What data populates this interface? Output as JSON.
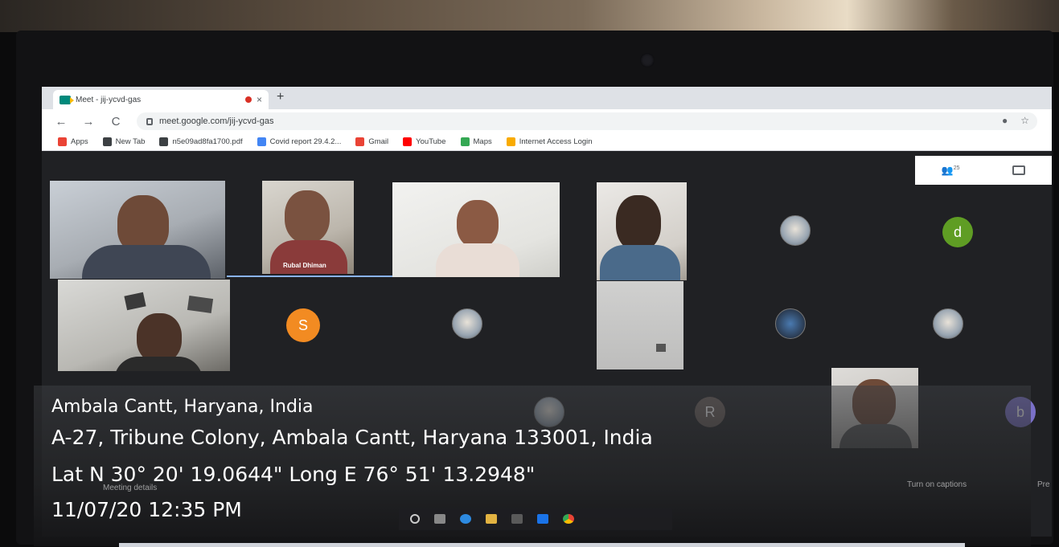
{
  "browser": {
    "tab_title": "Meet - jij-ycvd-gas",
    "tab_close": "×",
    "new_tab": "+",
    "back": "←",
    "forward": "→",
    "reload": "C",
    "url": "meet.google.com/jij-ycvd-gas",
    "bookmarks": [
      {
        "label": "Apps",
        "color": "#ea4335"
      },
      {
        "label": "New Tab",
        "color": "#3c4043"
      },
      {
        "label": "n5e09ad8fa1700.pdf",
        "color": "#3c4043"
      },
      {
        "label": "Covid report 29.4.2...",
        "color": "#4285f4"
      },
      {
        "label": "Gmail",
        "color": "#ea4335"
      },
      {
        "label": "YouTube",
        "color": "#ff0000"
      },
      {
        "label": "Maps",
        "color": "#34a853"
      },
      {
        "label": "Internet Access Login",
        "color": "#f9ab00"
      }
    ]
  },
  "meet": {
    "participant_count": "25",
    "tiles": [
      {
        "name": ""
      },
      {
        "name": "Rubal Dhiman"
      },
      {
        "name": ""
      },
      {
        "name": ""
      },
      {
        "name": ""
      }
    ],
    "avatars": [
      {
        "letter": "d",
        "color": "#5f9d24"
      },
      {
        "letter": "S",
        "color": "#f28b22"
      },
      {
        "letter": "R",
        "color": "#6b5f5a"
      },
      {
        "letter": "b",
        "color": "#7a70c8"
      }
    ],
    "footer": {
      "meeting_details": "Meeting details",
      "turn_on_captions": "Turn on captions",
      "present": "Pre"
    }
  },
  "overlay": {
    "place": "Ambala Cantt, Haryana, India",
    "address": "A-27, Tribune Colony, Ambala Cantt, Haryana 133001, India",
    "coords": "Lat N 30° 20' 19.0644\" Long E 76° 51' 13.2948\"",
    "datetime": "11/07/20 12:35 PM"
  }
}
